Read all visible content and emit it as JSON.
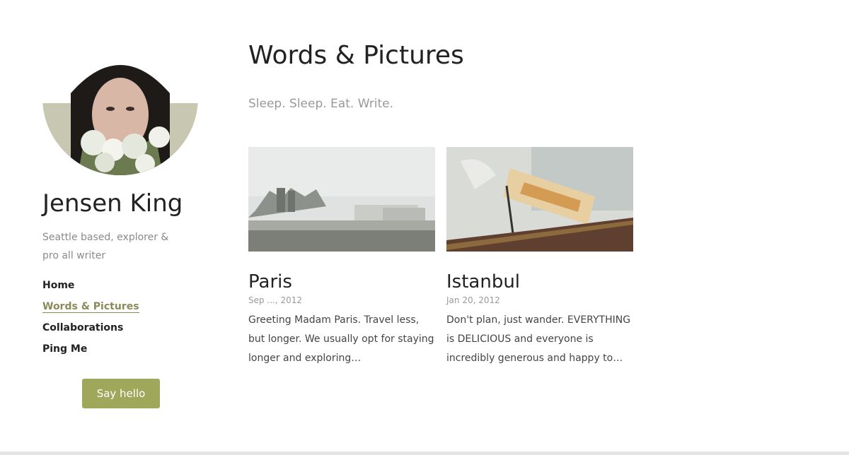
{
  "sidebar": {
    "name": "Jensen King",
    "bio": "Seattle based, explorer & pro all writer",
    "nav": [
      "Home",
      "Words & Pictures",
      "Collaborations",
      "Ping Me"
    ],
    "active_nav_index": 1,
    "cta_label": "Say hello"
  },
  "main": {
    "title": "Words & Pictures",
    "tagline": "Sleep. Sleep. Eat. Write.",
    "posts": [
      {
        "title": "Paris",
        "date": "Sep ..., 2012",
        "excerpt": "Greeting Madam Paris. Travel less, but longer. We usually opt for staying longer and exploring…"
      },
      {
        "title": "Istanbul",
        "date": "Jan 20, 2012",
        "excerpt": "Don't plan, just wander. EVERYTHING is DELICIOUS and everyone is incredibly generous and happy to…"
      }
    ]
  },
  "colors": {
    "accent": "#9fa75b",
    "nav_active": "#8a8a5a"
  }
}
